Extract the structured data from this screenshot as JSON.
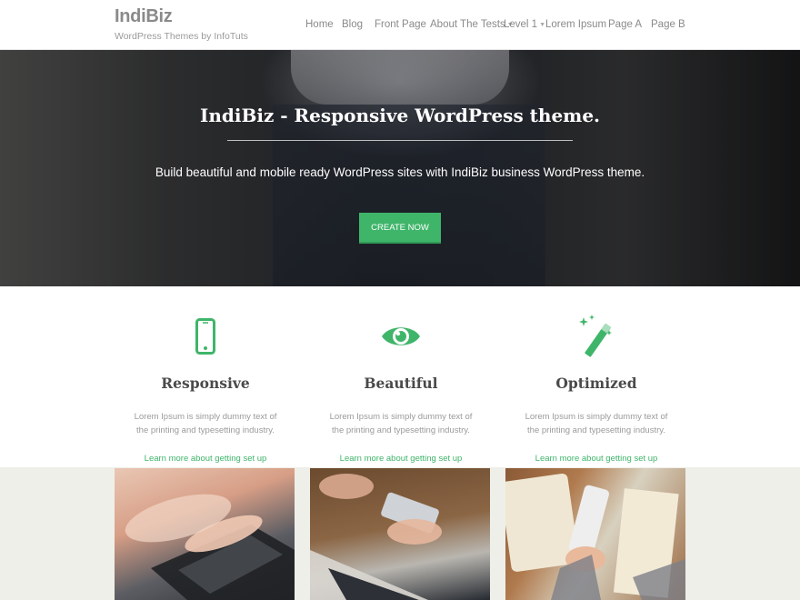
{
  "site": {
    "title": "IndiBiz",
    "tagline": "WordPress Themes by InfoTuts"
  },
  "nav": {
    "items": [
      {
        "label": "Home",
        "has_submenu": false
      },
      {
        "label": "Blog",
        "has_submenu": false
      },
      {
        "label": "Front Page",
        "has_submenu": false
      },
      {
        "label": "About The Tests",
        "has_submenu": true
      },
      {
        "label": "Level 1",
        "has_submenu": true
      },
      {
        "label": "Lorem Ipsum",
        "has_submenu": false
      },
      {
        "label": "Page A",
        "has_submenu": false
      },
      {
        "label": "Page B",
        "has_submenu": false
      }
    ]
  },
  "hero": {
    "title": "IndiBiz - Responsive WordPress theme.",
    "subtitle": "Build beautiful and mobile ready WordPress sites with IndiBiz business WordPress theme.",
    "button_label": "CREATE NOW"
  },
  "features": [
    {
      "icon": "mobile-phone-icon",
      "title": "Responsive",
      "text": "Lorem Ipsum is simply dummy text of the printing and typesetting industry.",
      "link": "Learn more about getting set up"
    },
    {
      "icon": "eye-icon",
      "title": "Beautiful",
      "text": "Lorem Ipsum is simply dummy text of the printing and typesetting industry.",
      "link": "Learn more about getting set up"
    },
    {
      "icon": "magic-wand-icon",
      "title": "Optimized",
      "text": "Lorem Ipsum is simply dummy text of the printing and typesetting industry.",
      "link": "Learn more about getting set up"
    }
  ],
  "gallery": [
    {
      "subject": "hands typing on laptop"
    },
    {
      "subject": "hands holding smartphone at desk"
    },
    {
      "subject": "hand holding phone over notebook"
    }
  ],
  "colors": {
    "accent": "#3fb56a",
    "header_text": "#8a8a8a",
    "gallery_bg": "#efefe9"
  }
}
